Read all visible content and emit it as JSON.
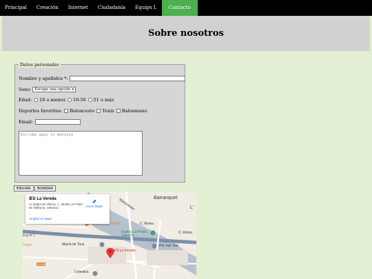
{
  "nav": {
    "items": [
      "Principal",
      "Creación",
      "Internet",
      "Ciudadanía",
      "Equips I.",
      "Contacto"
    ],
    "active_index": 5,
    "active_color": "#4caf50"
  },
  "header": {
    "title": "Sobre nosotros"
  },
  "form": {
    "legend": "Datos personales",
    "name_label": "Nombre y apellidos *:",
    "sex_label": "Sexo:",
    "sex_selected": "Escoge una opción",
    "age_label": "Edad:",
    "age_options": [
      "18 o menos",
      "19-50",
      "51 o más"
    ],
    "sports_label": "Deportes favoritos:",
    "sports_options": [
      "Baloncesto",
      "Tenis",
      "Balonmano"
    ],
    "email_label": "Email:",
    "message_placeholder": "Escribe aquí tu mensaje",
    "submit_label": "ENVIAR",
    "reset_label": "BORRAR"
  },
  "map": {
    "place_name": "IES La Vereda",
    "address": "C/ Isabel de Villena, 1, 46185 La Pobla de Vallbona, Valencia",
    "directions_label": "Cómo llegar",
    "larger_map_label": "Ampliar el mapa",
    "labels": {
      "barranquet": "Barranquet",
      "l_edge": "L'",
      "manchester": "Manchester",
      "terraza": "LA NUEVA TERRAZA",
      "c_roma": "C. Roma",
      "c_roma2": "C. Roma",
      "karting": "Karting La Pobla Valencia",
      "exp": "Exp N 1",
      "vegre": "Vegre",
      "masia": "Masía de Tous",
      "pol": "Pol. Ind. Oot",
      "ies": "IES La Vereda",
      "celestica": "Celestica",
      "road_cv": "CV-35"
    }
  }
}
